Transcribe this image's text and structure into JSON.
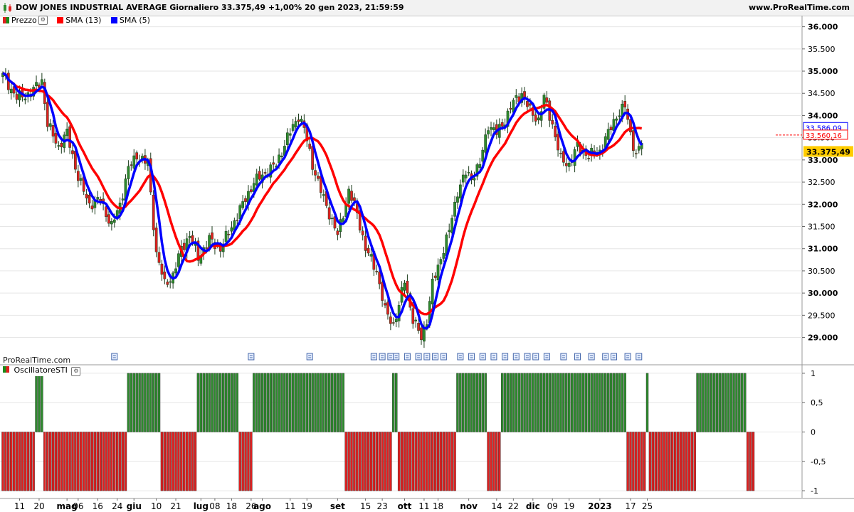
{
  "header": {
    "title": "DOW JONES INDUSTRIAL AVERAGE Giornaliero 33.375,49 +1,00% 20 gen 2023, 21:59:59",
    "site": "www.ProRealTime.com"
  },
  "legend": {
    "items": [
      {
        "label": "Prezzo",
        "color": "#1a8c1a"
      },
      {
        "label": "SMA (13)",
        "color": "#ff0000"
      },
      {
        "label": "SMA (5)",
        "color": "#0000ff"
      }
    ]
  },
  "watermark": "ProRealTime.com",
  "oscillator": {
    "label": "OscillatoreSTI"
  },
  "colors": {
    "up": "#2e8b2e",
    "down": "#e02020",
    "sma13": "#ff0000",
    "sma5": "#0000ff",
    "grid": "#e6e6e6"
  },
  "chart_data": {
    "type": "candlestick",
    "y_ticks": [
      "36.000",
      "35.500",
      "35.000",
      "34.500",
      "34.000",
      "33.500",
      "33.000",
      "32.500",
      "32.000",
      "31.500",
      "31.000",
      "30.500",
      "30.000",
      "29.500",
      "29.000"
    ],
    "y_tick_values": [
      36000,
      35500,
      35000,
      34500,
      34000,
      33500,
      33000,
      32500,
      32000,
      31500,
      31000,
      30500,
      30000,
      29500,
      29000
    ],
    "ylim": [
      28400,
      36250
    ],
    "price_labels": [
      {
        "text": "33.586,09",
        "value": 33586,
        "color": "#0000ff"
      },
      {
        "text": "33.560,16",
        "value": 33560,
        "color": "#ff0000"
      },
      {
        "text": "33.375,49",
        "value": 33375,
        "color": "#ffcc00"
      }
    ],
    "x_labels": [
      {
        "text": "11",
        "bar": 6,
        "bold": false
      },
      {
        "text": "20",
        "bar": 13,
        "bold": false
      },
      {
        "text": "mag",
        "bar": 23,
        "bold": true
      },
      {
        "text": "06",
        "bar": 27,
        "bold": false
      },
      {
        "text": "16",
        "bar": 34,
        "bold": false
      },
      {
        "text": "24",
        "bar": 41,
        "bold": false
      },
      {
        "text": "giu",
        "bar": 47,
        "bold": true
      },
      {
        "text": "10",
        "bar": 55,
        "bold": false
      },
      {
        "text": "21",
        "bar": 62,
        "bold": false
      },
      {
        "text": "lug",
        "bar": 71,
        "bold": true
      },
      {
        "text": "08",
        "bar": 76,
        "bold": false
      },
      {
        "text": "18",
        "bar": 82,
        "bold": false
      },
      {
        "text": "26",
        "bar": 89,
        "bold": false
      },
      {
        "text": "ago",
        "bar": 93,
        "bold": true
      },
      {
        "text": "11",
        "bar": 103,
        "bold": false
      },
      {
        "text": "19",
        "bar": 109,
        "bold": false
      },
      {
        "text": "set",
        "bar": 120,
        "bold": true
      },
      {
        "text": "15",
        "bar": 130,
        "bold": false
      },
      {
        "text": "23",
        "bar": 136,
        "bold": false
      },
      {
        "text": "ott",
        "bar": 144,
        "bold": true
      },
      {
        "text": "11",
        "bar": 151,
        "bold": false
      },
      {
        "text": "18",
        "bar": 156,
        "bold": false
      },
      {
        "text": "nov",
        "bar": 167,
        "bold": true
      },
      {
        "text": "14",
        "bar": 177,
        "bold": false
      },
      {
        "text": "22",
        "bar": 183,
        "bold": false
      },
      {
        "text": "dic",
        "bar": 190,
        "bold": true
      },
      {
        "text": "09",
        "bar": 197,
        "bold": false
      },
      {
        "text": "19",
        "bar": 203,
        "bold": false
      },
      {
        "text": "2023",
        "bar": 214,
        "bold": true
      },
      {
        "text": "17",
        "bar": 225,
        "bold": false
      },
      {
        "text": "25",
        "bar": 231,
        "bold": false
      }
    ],
    "event_bars": [
      40,
      89,
      110,
      133,
      136,
      139,
      141,
      145,
      149,
      152,
      155,
      158,
      164,
      168,
      172,
      176,
      180,
      184,
      188,
      191,
      195,
      201,
      206,
      211,
      216,
      219,
      224,
      228
    ],
    "anchors": [
      [
        0,
        34900
      ],
      [
        5,
        34400
      ],
      [
        10,
        34500
      ],
      [
        14,
        34800
      ],
      [
        16,
        33800
      ],
      [
        20,
        33300
      ],
      [
        23,
        33600
      ],
      [
        27,
        32600
      ],
      [
        31,
        32000
      ],
      [
        35,
        32100
      ],
      [
        39,
        31500
      ],
      [
        42,
        32000
      ],
      [
        45,
        32800
      ],
      [
        48,
        33100
      ],
      [
        52,
        32900
      ],
      [
        55,
        30900
      ],
      [
        58,
        30200
      ],
      [
        61,
        30400
      ],
      [
        64,
        31000
      ],
      [
        67,
        31300
      ],
      [
        70,
        30800
      ],
      [
        74,
        31200
      ],
      [
        78,
        31000
      ],
      [
        82,
        31500
      ],
      [
        86,
        32000
      ],
      [
        90,
        32500
      ],
      [
        94,
        32700
      ],
      [
        98,
        32900
      ],
      [
        102,
        33500
      ],
      [
        106,
        34000
      ],
      [
        108,
        33700
      ],
      [
        111,
        32900
      ],
      [
        114,
        32300
      ],
      [
        117,
        31800
      ],
      [
        120,
        31300
      ],
      [
        124,
        32300
      ],
      [
        127,
        31800
      ],
      [
        130,
        31000
      ],
      [
        134,
        30500
      ],
      [
        137,
        29600
      ],
      [
        140,
        29300
      ],
      [
        142,
        29700
      ],
      [
        144,
        30300
      ],
      [
        147,
        29400
      ],
      [
        150,
        29000
      ],
      [
        152,
        29400
      ],
      [
        154,
        30200
      ],
      [
        157,
        30800
      ],
      [
        160,
        31400
      ],
      [
        163,
        32300
      ],
      [
        166,
        32700
      ],
      [
        168,
        32600
      ],
      [
        171,
        32900
      ],
      [
        174,
        33800
      ],
      [
        177,
        33600
      ],
      [
        180,
        33900
      ],
      [
        183,
        34300
      ],
      [
        186,
        34500
      ],
      [
        189,
        34100
      ],
      [
        192,
        33900
      ],
      [
        194,
        34400
      ],
      [
        197,
        33800
      ],
      [
        200,
        33000
      ],
      [
        203,
        32900
      ],
      [
        206,
        33300
      ],
      [
        210,
        33100
      ],
      [
        214,
        33200
      ],
      [
        217,
        33600
      ],
      [
        220,
        34000
      ],
      [
        223,
        34200
      ],
      [
        225,
        33600
      ],
      [
        227,
        33100
      ],
      [
        229,
        33375
      ]
    ],
    "oscillator_values": [
      -1,
      -1,
      -1,
      -1,
      -1,
      -1,
      -1,
      -1,
      -1,
      -1,
      -1,
      -1,
      1,
      1,
      1,
      -1,
      -1,
      -1,
      -1,
      -1,
      -1,
      -1,
      -1,
      -1,
      -1,
      -1,
      -1,
      -1,
      -1,
      -1,
      -1,
      -1,
      -1,
      -1,
      -1,
      -1,
      -1,
      -1,
      -1,
      -1,
      -1,
      -1,
      -1,
      -1,
      -1,
      1,
      1,
      1,
      1,
      1,
      1,
      1,
      1,
      1,
      1,
      1,
      1,
      -1,
      -1,
      -1,
      -1,
      -1,
      -1,
      -1,
      -1,
      -1,
      -1,
      -1,
      -1,
      -1,
      1,
      1,
      1,
      1,
      1,
      1,
      1,
      1,
      1,
      1,
      1,
      1,
      1,
      1,
      1,
      -1,
      -1,
      -1,
      -1,
      -1,
      1,
      1,
      1,
      1,
      1,
      1,
      1,
      1,
      1,
      1,
      1,
      1,
      1,
      1,
      1,
      1,
      1,
      1,
      1,
      1,
      1,
      1,
      1,
      1,
      1,
      1,
      1,
      1,
      1,
      1,
      1,
      1,
      1,
      -1,
      -1,
      -1,
      -1,
      -1,
      -1,
      -1,
      -1,
      -1,
      -1,
      -1,
      -1,
      -1,
      -1,
      -1,
      -1,
      -1,
      1,
      1,
      -1,
      -1,
      -1,
      -1,
      -1,
      -1,
      -1,
      -1,
      -1,
      -1,
      -1,
      -1,
      -1,
      -1,
      -1,
      -1,
      -1,
      -1,
      -1,
      -1,
      -1,
      1,
      1,
      1,
      1,
      1,
      1,
      1,
      1,
      1,
      1,
      1,
      -1,
      -1,
      -1,
      -1,
      -1,
      1,
      1,
      1,
      1,
      1,
      1,
      1,
      1,
      1,
      1,
      1,
      1,
      1,
      1,
      1,
      1,
      1,
      1,
      1,
      1,
      1,
      1,
      1,
      1,
      1,
      1,
      1,
      1,
      1,
      1,
      1,
      1,
      1,
      1,
      1,
      1,
      1,
      1,
      1,
      1,
      1,
      1,
      1,
      1,
      1,
      -1,
      -1,
      -1,
      -1,
      -1,
      -1,
      -1,
      1,
      -1,
      -1,
      -1,
      -1,
      -1,
      -1,
      -1,
      -1,
      -1,
      -1,
      -1,
      -1,
      -1,
      -1,
      -1,
      -1,
      -1,
      1,
      1,
      1,
      1,
      1,
      1,
      1,
      1,
      1,
      1,
      1,
      1,
      1,
      1,
      1,
      1,
      1,
      1,
      -1,
      -1,
      -1
    ],
    "oscillator_ticks": [
      "1",
      "0,5",
      "0",
      "-0,5",
      "-1"
    ],
    "oscillator_tick_values": [
      1,
      0.5,
      0,
      -0.5,
      -1
    ],
    "oscillator_ylim": [
      -1.12,
      1.12
    ]
  }
}
